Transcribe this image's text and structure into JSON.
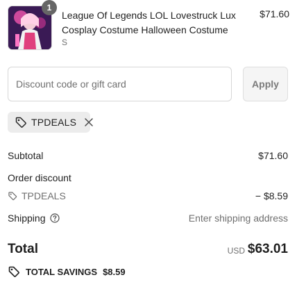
{
  "product": {
    "quantity": "1",
    "title": "League Of Legends LOL Lovestruck Lux Cosplay Costume Halloween Costume",
    "variant": "S",
    "price": "$71.60"
  },
  "discount": {
    "placeholder": "Discount code or gift card",
    "value": "",
    "apply_label": "Apply"
  },
  "applied_code": {
    "code": "TPDEALS"
  },
  "summary": {
    "subtotal_label": "Subtotal",
    "subtotal_value": "$71.60",
    "order_discount_label": "Order discount",
    "discount_code": "TPDEALS",
    "discount_value": "− $8.59",
    "shipping_label": "Shipping",
    "shipping_value": "Enter shipping address"
  },
  "total": {
    "label": "Total",
    "currency": "USD",
    "amount": "$63.01"
  },
  "savings": {
    "label": "TOTAL SAVINGS",
    "value": "$8.59"
  },
  "icons": {
    "tag": "tag-icon",
    "close": "close-icon",
    "help": "help-circle-icon"
  },
  "colors": {
    "badge": "#666666",
    "chip_bg": "#ececec",
    "button_bg": "#f5f5f5",
    "border": "#d6d6d6"
  }
}
